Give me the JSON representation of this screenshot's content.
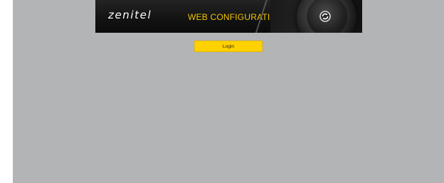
{
  "header": {
    "logo_text": "zenitel",
    "title": "WEB CONFIGURATION",
    "speaker_icon": "speaker-icon"
  },
  "login": {
    "button_label": "Login"
  },
  "colors": {
    "banner_bg": "#141414",
    "accent_yellow": "#f2c500",
    "page_bg": "#b3b4b6"
  }
}
